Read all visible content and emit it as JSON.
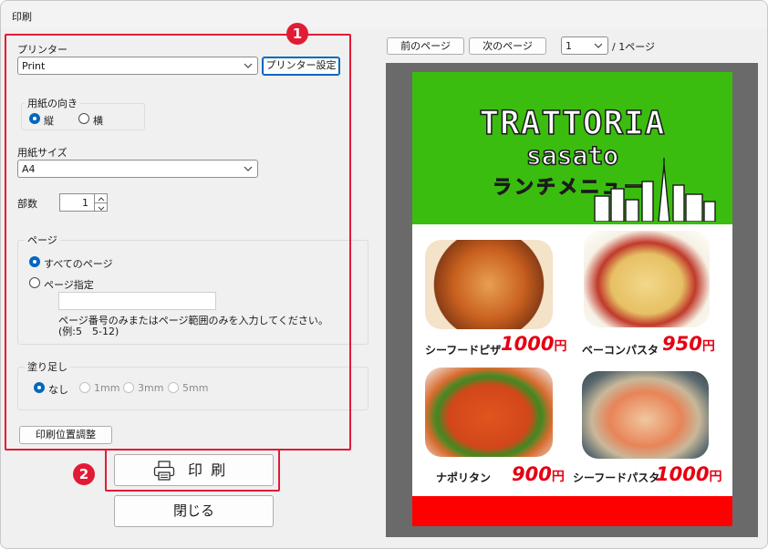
{
  "window": {
    "title": "印刷"
  },
  "printer": {
    "label": "プリンター",
    "selected": "Print",
    "settings_button": "プリンター設定"
  },
  "orientation": {
    "label": "用紙の向き",
    "options": [
      "縦",
      "横"
    ],
    "selected_index": 0
  },
  "paper_size": {
    "label": "用紙サイズ",
    "selected": "A4"
  },
  "copies": {
    "label": "部数",
    "value": "1"
  },
  "pages": {
    "label": "ページ",
    "option_all": "すべてのページ",
    "option_range": "ページ指定",
    "range_value": "",
    "hint_line1": "ページ番号のみまたはページ範囲のみを入力してください。",
    "hint_line2": "(例:5　5-12)"
  },
  "bleed": {
    "label": "塗り足し",
    "options": [
      "なし",
      "1mm",
      "3mm",
      "5mm"
    ],
    "selected_index": 0
  },
  "adjust_button": "印刷位置調整",
  "print_button": "印 刷",
  "close_button": "閉じる",
  "badges": [
    "1",
    "2"
  ],
  "preview": {
    "prev_page": "前のページ",
    "next_page": "次のページ",
    "page_select": "1",
    "page_total": "/ 1ページ",
    "flyer": {
      "name_line1": "TRATTORIA",
      "name_line2": "sasato",
      "subtitle": "ランチメニュー",
      "items": [
        {
          "name": "シーフードピザ",
          "price": "1000",
          "currency": "円"
        },
        {
          "name": "ベーコンパスタ",
          "price": "950",
          "currency": "円"
        },
        {
          "name": "ナポリタン",
          "price": "900",
          "currency": "円"
        },
        {
          "name": "シーフードパスタ",
          "price": "1000",
          "currency": "円"
        }
      ]
    }
  },
  "colors": {
    "accent_red": "#e21b35",
    "radio_blue": "#0067c0",
    "flyer_green": "#3bbd0f",
    "price_red": "#e60012"
  },
  "icons": [
    "chevron-down-icon",
    "printer-icon",
    "spinner-up-icon",
    "spinner-down-icon"
  ]
}
